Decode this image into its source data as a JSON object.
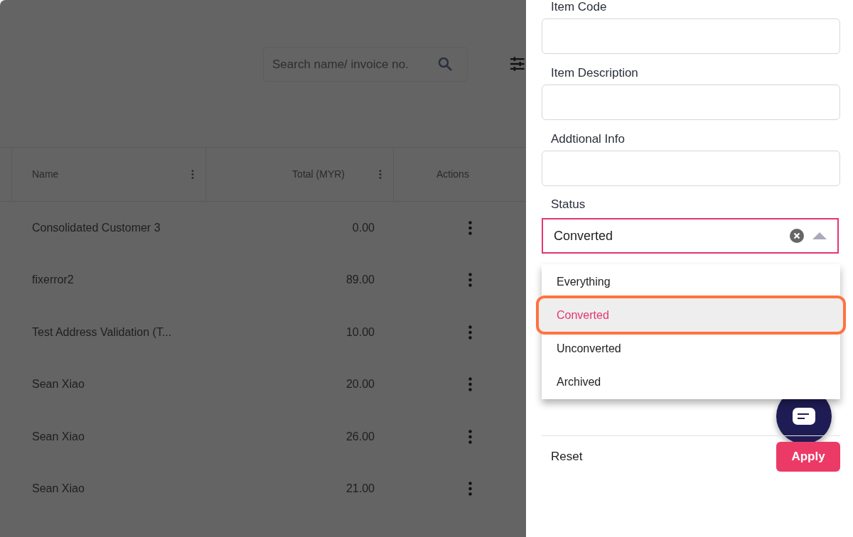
{
  "search": {
    "placeholder": "Search name/ invoice no."
  },
  "table": {
    "columns": [
      "Name",
      "Total (MYR)",
      "Actions"
    ],
    "rows": [
      {
        "name": "Consolidated Customer 3",
        "total": "0.00"
      },
      {
        "name": "fixerror2",
        "total": "89.00"
      },
      {
        "name": "Test Address Validation (T...",
        "total": "10.00"
      },
      {
        "name": "Sean Xiao",
        "total": "20.00"
      },
      {
        "name": "Sean Xiao",
        "total": "26.00"
      },
      {
        "name": "Sean Xiao",
        "total": "21.00"
      }
    ]
  },
  "filter_panel": {
    "fields": [
      {
        "label": "Item Code"
      },
      {
        "label": "Item Description"
      },
      {
        "label": "Addtional Info"
      }
    ],
    "status": {
      "label": "Status",
      "value": "Converted",
      "expanded": true,
      "options": [
        {
          "label": "Everything",
          "selected": false
        },
        {
          "label": "Converted",
          "selected": true
        },
        {
          "label": "Unconverted",
          "selected": false
        },
        {
          "label": "Archived",
          "selected": false
        }
      ]
    },
    "buttons": {
      "reset": "Reset",
      "apply": "Apply"
    }
  }
}
